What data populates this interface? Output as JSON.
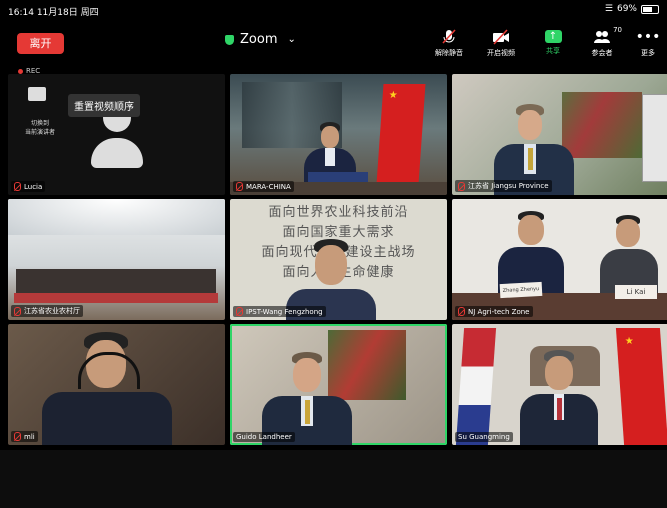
{
  "status_bar": {
    "time": "16:14",
    "date": "11月18日 周四",
    "wifi_icon": "wifi-icon",
    "battery": "69%"
  },
  "top_bar": {
    "leave_label": "离开",
    "title": "Zoom",
    "tools": [
      {
        "name": "unmute",
        "label": "解除静音",
        "icon": "mic-muted-icon"
      },
      {
        "name": "start-video",
        "label": "开启视频",
        "icon": "video-off-icon"
      },
      {
        "name": "share",
        "label": "共享",
        "icon": "share-icon"
      },
      {
        "name": "participants",
        "label": "参会者",
        "icon": "participants-icon",
        "count": "70"
      },
      {
        "name": "more",
        "label": "更多",
        "icon": "more-icon"
      }
    ]
  },
  "recording": {
    "label": "REC"
  },
  "self_tile": {
    "switch_label_line1": "切换到",
    "switch_label_line2": "当前演讲者",
    "reorder_label": "重置视频顺序"
  },
  "tiles": [
    {
      "name": "Lucia"
    },
    {
      "name": "MARA-CHINA"
    },
    {
      "name": "江苏省 Jiangsu Province"
    },
    {
      "name": "江苏省农业农村厅"
    },
    {
      "name": "IPST-Wang Fengzhong"
    },
    {
      "name": "NJ Agri-tech Zone"
    },
    {
      "name": "mli"
    },
    {
      "name": "Guido Landheer"
    },
    {
      "name": "Su Guangming"
    }
  ],
  "banner_text": {
    "line1": "面向世界农业科技前沿",
    "line2": "面向国家重大需求",
    "line3": "面向现代农业建设主战场",
    "line4": "面向人民生命健康"
  },
  "desk_labels": {
    "left": "Zhang Zhenyu",
    "right": "Li Kai"
  },
  "colors": {
    "accent_green": "#2fd567",
    "leave_red": "#e53935"
  }
}
